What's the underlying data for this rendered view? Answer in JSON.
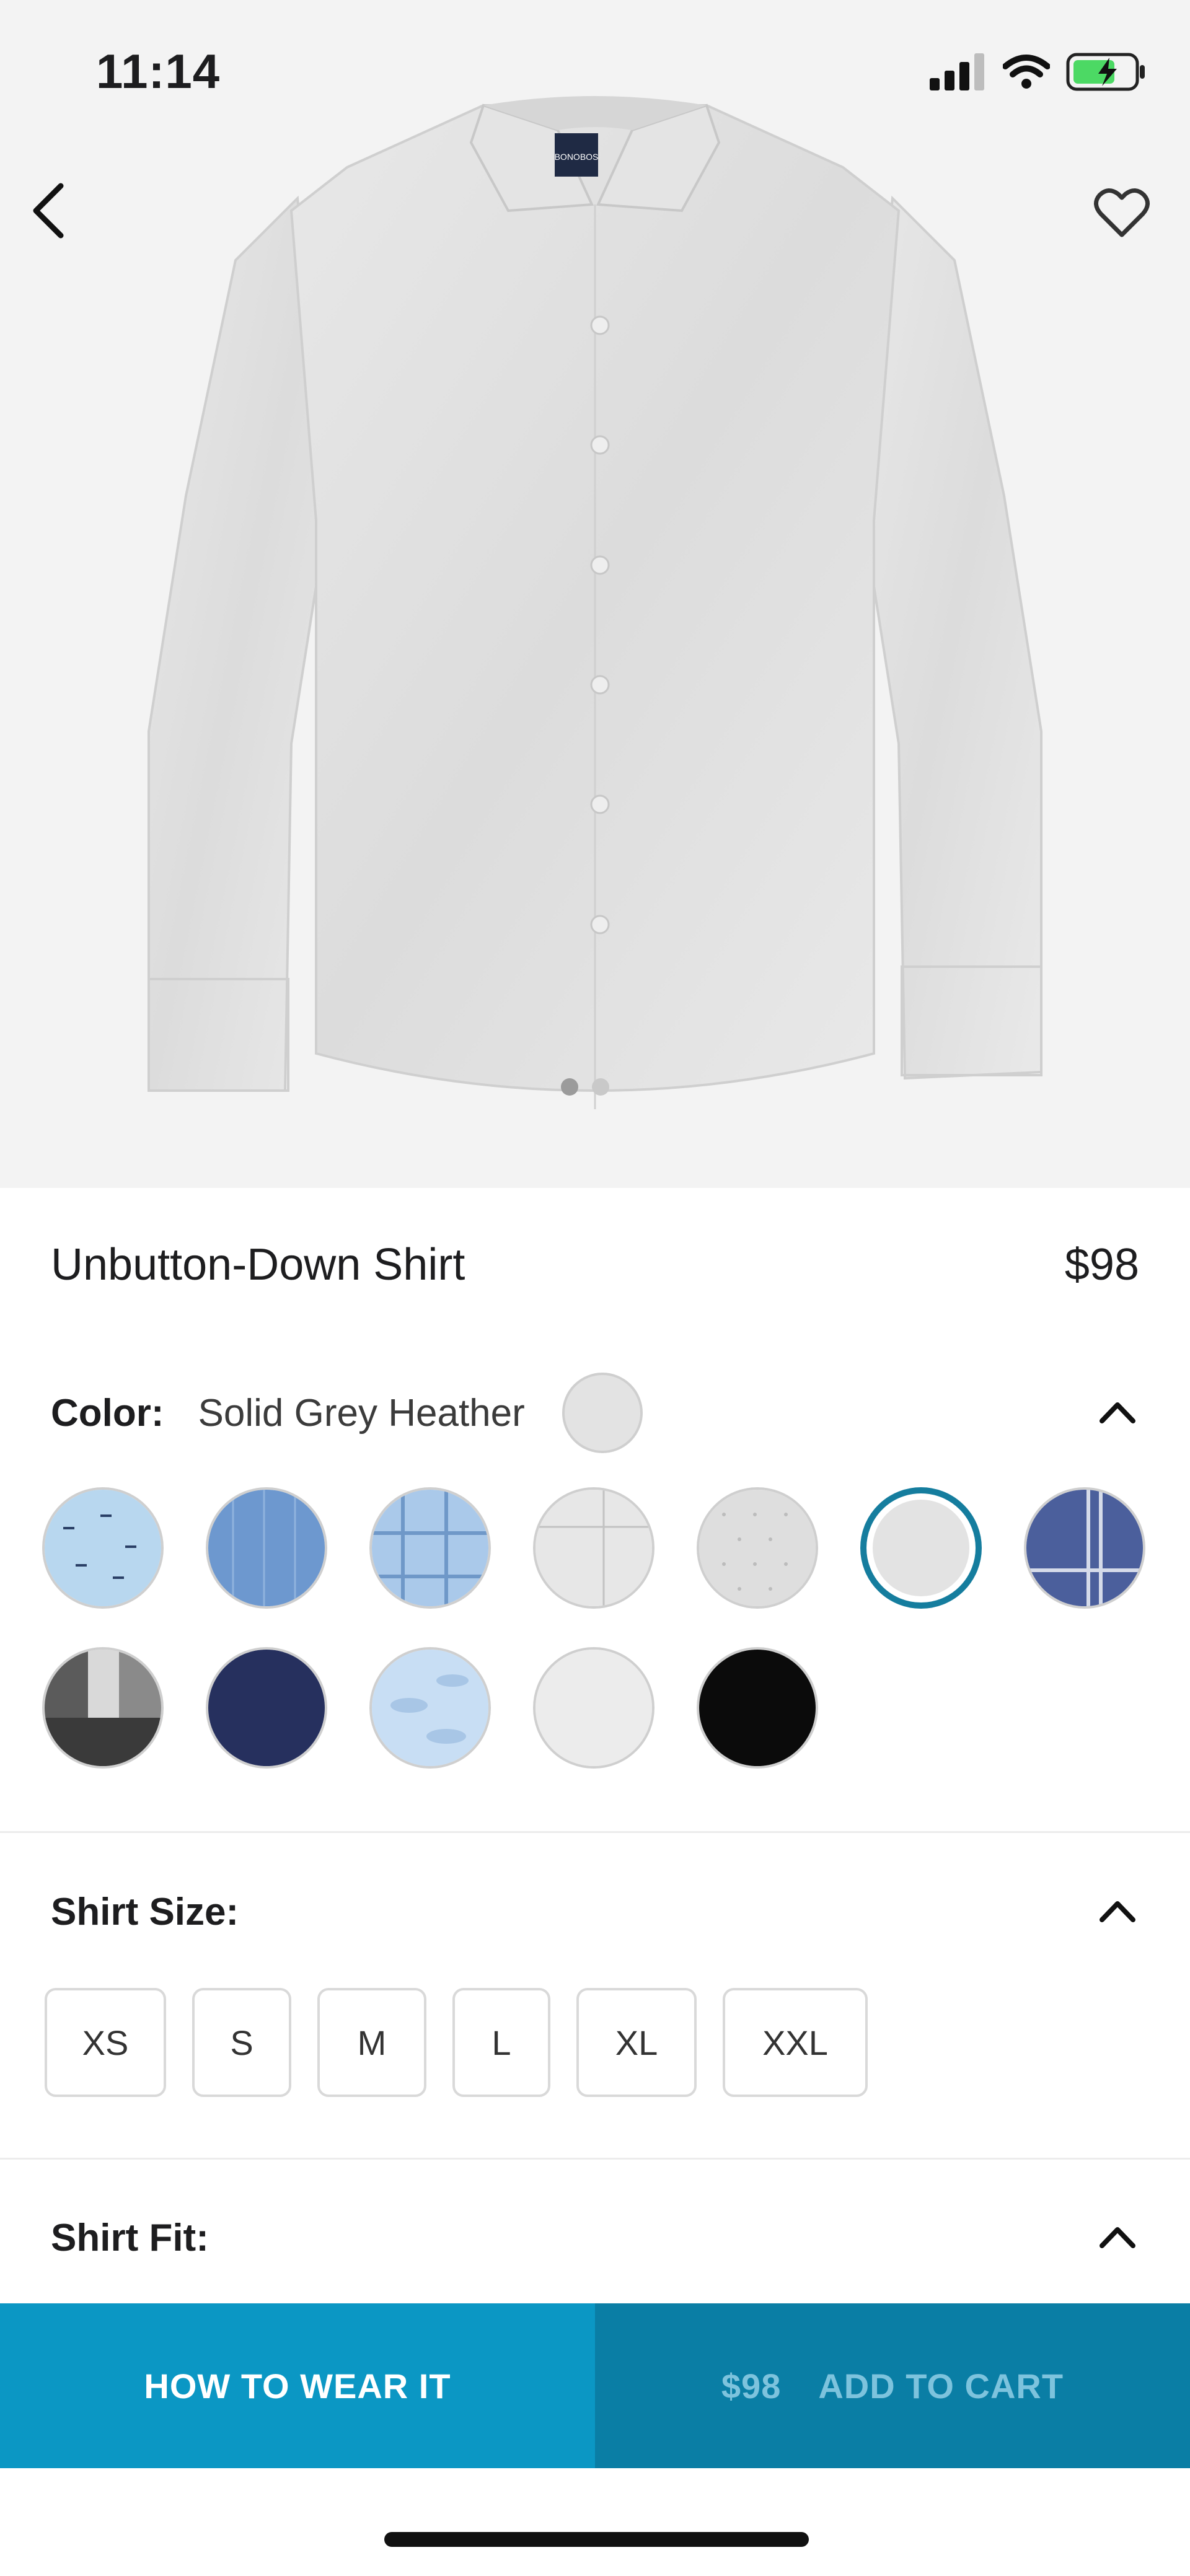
{
  "status_bar": {
    "time": "11:14"
  },
  "product": {
    "name": "Unbutton-Down Shirt",
    "price": "$98",
    "brand_label": "BONOBOS"
  },
  "color": {
    "label": "Color:",
    "selected_name": "Solid Grey Heather",
    "swatches": [
      {
        "name": "light-blue-print",
        "base": "#b8d7ef"
      },
      {
        "name": "chambray-blue",
        "base": "#6d98cf"
      },
      {
        "name": "blue-plaid",
        "base": "#aac9ea"
      },
      {
        "name": "light-grey-grid",
        "base": "#e7e7e7"
      },
      {
        "name": "grey-dot",
        "base": "#dedede"
      },
      {
        "name": "solid-grey-heather",
        "base": "#e3e3e3",
        "selected": true
      },
      {
        "name": "navy-plaid",
        "base": "#4b5f9c"
      },
      {
        "name": "black-white-check",
        "base": "#5b5b5b"
      },
      {
        "name": "navy",
        "base": "#26305e"
      },
      {
        "name": "sky-print",
        "base": "#c8def4"
      },
      {
        "name": "white",
        "base": "#ececec"
      },
      {
        "name": "black",
        "base": "#0b0b0b"
      }
    ]
  },
  "size": {
    "label": "Shirt Size:",
    "options": [
      "XS",
      "S",
      "M",
      "L",
      "XL",
      "XXL"
    ]
  },
  "fit": {
    "label": "Shirt Fit:"
  },
  "actions": {
    "how_to_wear": "HOW TO WEAR IT",
    "cart_price": "$98",
    "add_to_cart": "ADD TO CART"
  },
  "colors": {
    "accent": "#0b97c4",
    "accent_dark": "#0a7ea5",
    "selected_ring": "#157d9e"
  }
}
